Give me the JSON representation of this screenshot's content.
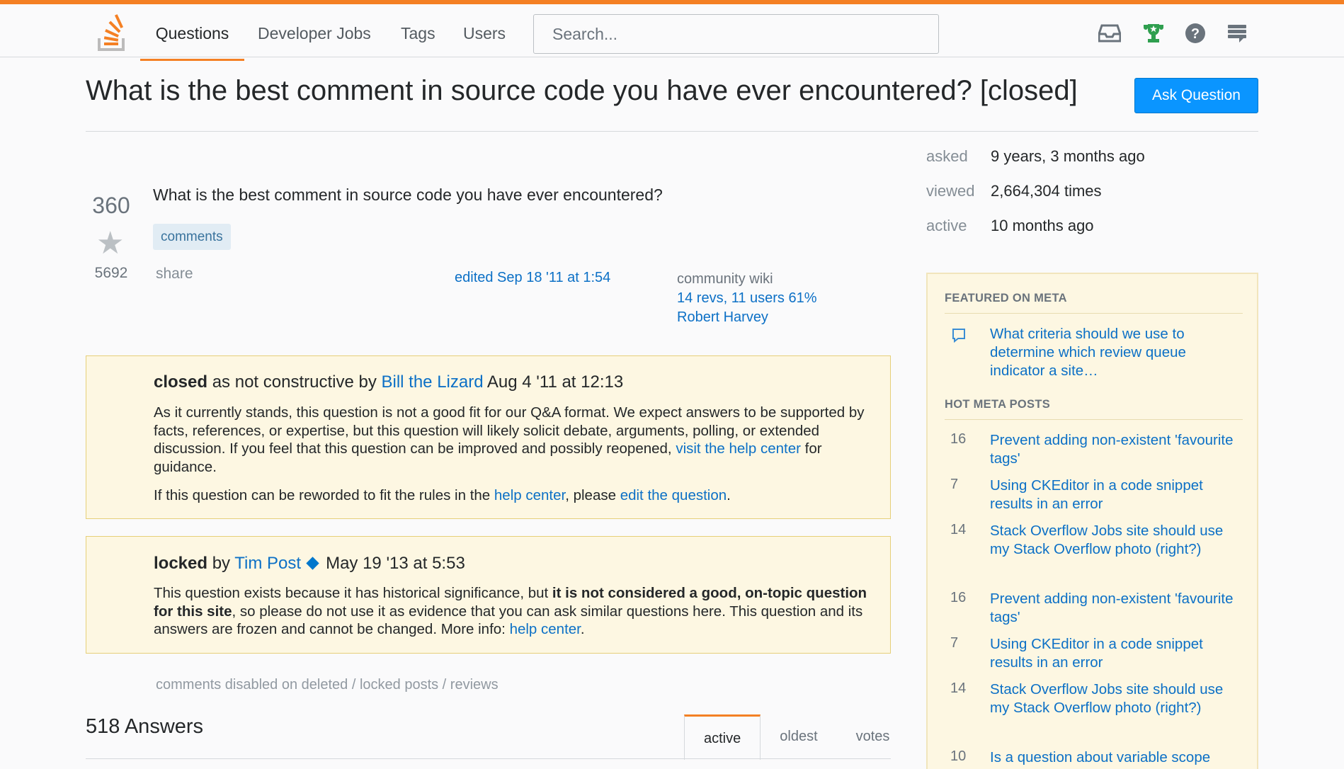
{
  "nav": {
    "items": [
      "Questions",
      "Developer Jobs",
      "Tags",
      "Users"
    ],
    "search_placeholder": "Search..."
  },
  "icons": [
    "inbox-icon",
    "achievements-icon",
    "help-icon",
    "site-switcher-icon"
  ],
  "colors": {
    "accent": "#f48024",
    "link": "#0c70c6",
    "button": "#0a95ff",
    "notice_bg": "#fdf7e2"
  },
  "question": {
    "title": "What is the best comment in source code you have ever encountered? [closed]",
    "ask_button": "Ask Question",
    "votes": "360",
    "favorites": "5692",
    "body": "What is the best comment in source code you have ever encountered?",
    "tag": "comments",
    "share": "share",
    "edited": "edited Sep 18 '11 at 1:54",
    "wiki_label": "community wiki",
    "wiki_revs": "14 revs, 11 users 61%",
    "wiki_user": "Robert Harvey"
  },
  "closed_notice": {
    "status": "closed",
    "reason": " as not constructive by ",
    "user": "Bill the Lizard",
    "date": " Aug 4 '11 at 12:13",
    "text1": "As it currently stands, this question is not a good fit for our Q&A format. We expect answers to be supported by facts, references, or expertise, but this question will likely solicit debate, arguments, polling, or extended discussion. If you feel that this question can be improved and possibly reopened, ",
    "help_link": "visit the help center",
    "text2": " for guidance.",
    "text3": "If this question can be reworded to fit the rules in the ",
    "help_center": "help center",
    "text4": ", please ",
    "edit_link": "edit the question",
    "text5": "."
  },
  "locked_notice": {
    "status": "locked",
    "by": " by ",
    "user": "Tim Post",
    "date": "May 19 '13 at 5:53",
    "text1": "This question exists because it has historical significance, but ",
    "bold": "it is not considered a good, on-topic question for this site",
    "text2": ", so please do not use it as evidence that you can ask similar questions here. This question and its answers are frozen and cannot be changed. More info: ",
    "help_link": "help center",
    "text3": "."
  },
  "comments_disabled": "comments disabled on deleted / locked posts / reviews",
  "answers": {
    "count_label": "518 Answers",
    "tabs": [
      "active",
      "oldest",
      "votes"
    ]
  },
  "meta": [
    {
      "label": "asked",
      "value": "9 years, 3 months ago"
    },
    {
      "label": "viewed",
      "value": "2,664,304 times"
    },
    {
      "label": "active",
      "value": "10 months ago"
    }
  ],
  "sidebar": {
    "featured_head": "FEATURED ON META",
    "featured": "What criteria should we use to determine which review queue indicator a site…",
    "hot_head": "HOT META POSTS",
    "hot": [
      {
        "num": "16",
        "title": "Prevent adding non-existent 'favourite tags'"
      },
      {
        "num": "7",
        "title": "Using CKEditor in a code snippet results in an error"
      },
      {
        "num": "14",
        "title": "Stack Overflow Jobs site should use my Stack Overflow photo (right?)"
      },
      {
        "num": "16",
        "title": "Prevent adding non-existent 'favourite tags'"
      },
      {
        "num": "7",
        "title": "Using CKEditor in a code snippet results in an error"
      },
      {
        "num": "14",
        "title": "Stack Overflow Jobs site should use my Stack Overflow photo (right?)"
      },
      {
        "num": "10",
        "title": "Is a question about variable scope"
      }
    ]
  }
}
